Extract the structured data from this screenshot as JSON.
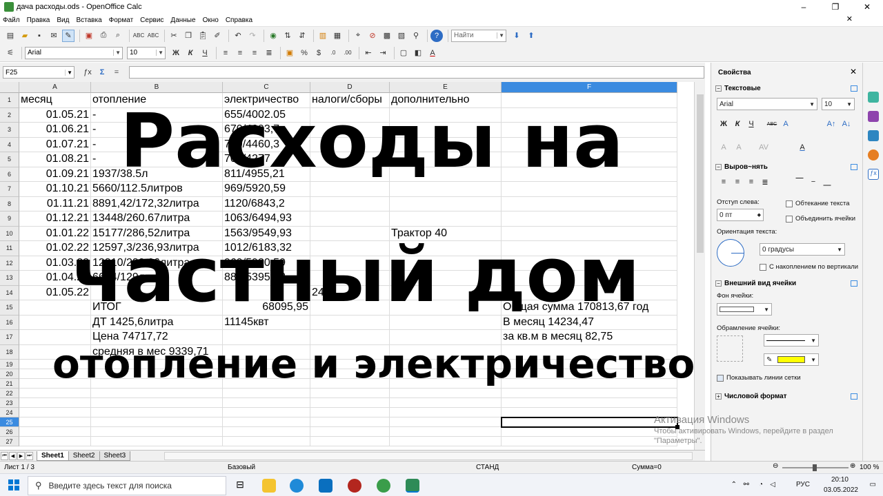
{
  "window": {
    "title": "дача расходы.ods - OpenOffice Calc",
    "controls": [
      "–",
      "❐",
      "✕"
    ]
  },
  "menu": [
    "Файл",
    "Правка",
    "Вид",
    "Вставка",
    "Формат",
    "Сервис",
    "Данные",
    "Окно",
    "Справка"
  ],
  "toolbar": {
    "find_placeholder": "Найти",
    "font_name": "Arial",
    "font_size": "10",
    "bold": "Ж",
    "italic": "К",
    "underline": "Ч"
  },
  "formula_bar": {
    "cell_ref": "F25",
    "func_icon": "ƒx",
    "sum_icon": "Σ",
    "equals": "="
  },
  "sheet": {
    "columns": [
      "A",
      "B",
      "C",
      "D",
      "E",
      "F"
    ],
    "selected_column": "F",
    "rows": [
      "1",
      "2",
      "3",
      "4",
      "5",
      "6",
      "7",
      "8",
      "9",
      "10",
      "11",
      "12",
      "13",
      "14",
      "15",
      "16",
      "17",
      "18",
      "19",
      "20",
      "21",
      "22",
      "23",
      "24",
      "25",
      "26",
      "27"
    ],
    "selected_row": "25",
    "cells": {
      "A1": "месяц",
      "B1": "отопление",
      "C1": "электричество",
      "D1": "налоги/сборы",
      "E1": "дополнительно",
      "A2": "01.05.21",
      "B2": "-",
      "C2": "655/4002.05",
      "A3": "01.06.21",
      "B3": "-",
      "C3": "670/4093,7",
      "A4": "01.07.21",
      "B4": "-",
      "C4": "730/4460,3",
      "A5": "01.08.21",
      "B5": "-",
      "C5": "700/4277",
      "A6": "01.09.21",
      "B6": "1937/38.5л",
      "C6": "811/4955,21",
      "A7": "01.10.21",
      "B7": "5660/112.5литров",
      "C7": "969/5920,59",
      "A8": "01.11.21",
      "B8": "8891,42/172,32литра",
      "C8": "1120/6843,2",
      "A9": "01.12.21",
      "B9": "13448/260.67литра",
      "C9": "1063/6494,93",
      "A10": "01.01.22",
      "B10": "15177/286,52литра",
      "C10": "1563/9549,93",
      "E10": "Трактор 40",
      "A11": "01.02.22",
      "B11": "12597,3/236,93литра",
      "C11": "1012/6183,32",
      "A12": "01.03.22",
      "B12": "12310/230,06литра",
      "C12": "969/5920,59",
      "A13": "01.04.22",
      "B13": "6694/129литра",
      "C13": "883/5395,13",
      "A14": "01.05.22",
      "D14": "24",
      "B15": "ИТОГ",
      "C15": "68095,95",
      "F15": "Общая сумма 170813,67 год",
      "B16": "ДТ 1425,6литра",
      "C16": "11145квт",
      "F16": "В месяц 14234,47",
      "B17": "Цена 74717,72",
      "F17": "за кв.м в месяц 82,75",
      "B18": "средняя в мес 9339,71"
    },
    "tabs": [
      "Sheet1",
      "Sheet2",
      "Sheet3"
    ],
    "active_tab": "Sheet1"
  },
  "sidebar": {
    "title": "Свойства",
    "sections": {
      "text": "Текстовые",
      "align": "Выров~нять",
      "cell_appearance": "Внешний вид ячейки",
      "number_format": "Числовой формат"
    },
    "font_name": "Arial",
    "font_size": "10",
    "indent_label": "Отступ слева:",
    "indent_value": "0 пт",
    "wrap_label": "Обтекание текста",
    "merge_label": "Объединить ячейки",
    "orientation_label": "Ориентация текста:",
    "orientation_value": "0 градусы",
    "stacked_label": "С накоплением по вертикали",
    "cell_bg_label": "Фон ячейки:",
    "border_label": "Обрамление ячейки:",
    "gridlines_label": "Показывать линии сетки",
    "colors": {
      "highlight": "#ffff00",
      "selection": "#3b8be0"
    }
  },
  "status": {
    "sheet": "Лист 1 / 3",
    "style": "Базовый",
    "mode": "СТАНД",
    "sum": "Сумма=0",
    "zoom": "100 %"
  },
  "activation": {
    "title": "Активация Windows",
    "line1": "Чтобы активировать Windows, перейдите в раздел",
    "line2": "\"Параметры\"."
  },
  "taskbar": {
    "search_placeholder": "Введите здесь текст для поиска",
    "lang": "РУС",
    "time": "20:10",
    "date": "03.05.2022"
  },
  "overlay": {
    "line1": "Расходы на",
    "line2": "частный дом",
    "line3": "отопление и электричество"
  }
}
